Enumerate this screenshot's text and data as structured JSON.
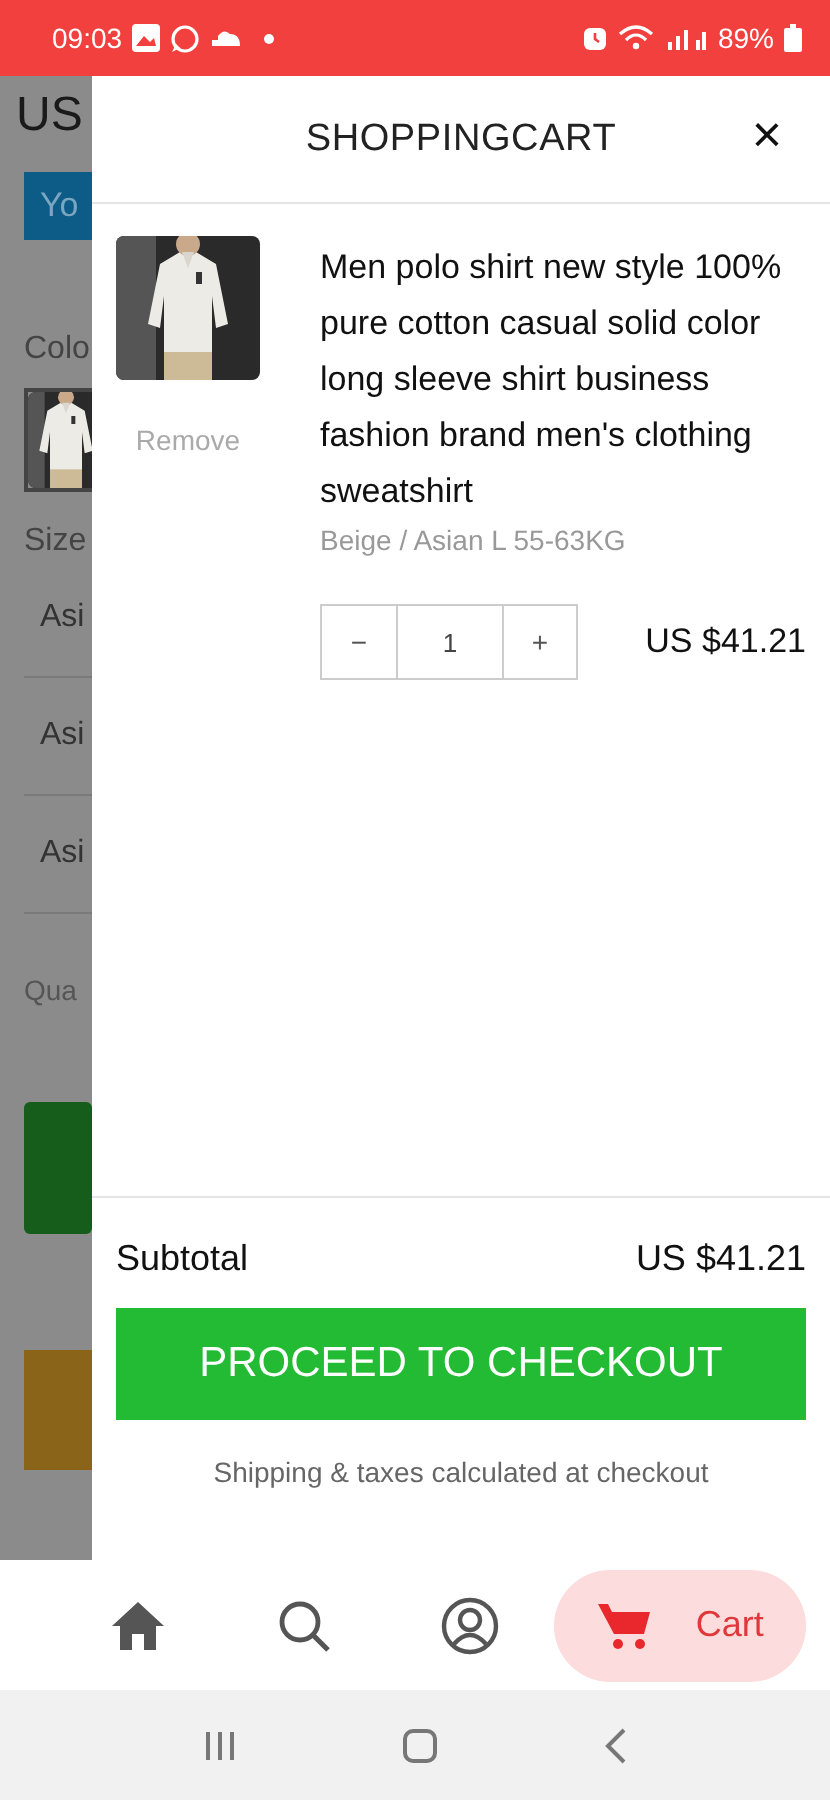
{
  "status_bar": {
    "time": "09:03",
    "battery": "89%"
  },
  "background_page": {
    "price": "US",
    "button": "Yo",
    "color_label": "Colo",
    "size_label": "Size",
    "size_options": [
      "Asi",
      "Asi",
      "Asi"
    ],
    "quantity_label": "Qua"
  },
  "cart": {
    "title": "SHOPPINGCART",
    "close": "×",
    "items": [
      {
        "title": "Men polo shirt new style 100% pure cotton casual solid color long sleeve shirt business fashion brand men's clothing sweatshirt",
        "variant": "Beige / Asian L 55-63KG",
        "remove": "Remove",
        "decrement": "−",
        "quantity": "1",
        "increment": "+",
        "price": "US $41.21"
      }
    ],
    "subtotal_label": "Subtotal",
    "subtotal": "US $41.21",
    "checkout": "PROCEED TO CHECKOUT",
    "note": "Shipping & taxes calculated at checkout"
  },
  "bottom_nav": [
    {
      "kind": "home",
      "selected": false
    },
    {
      "kind": "search",
      "selected": false
    },
    {
      "kind": "account",
      "selected": false
    },
    {
      "kind": "cart",
      "label": "Cart",
      "selected": true
    }
  ]
}
